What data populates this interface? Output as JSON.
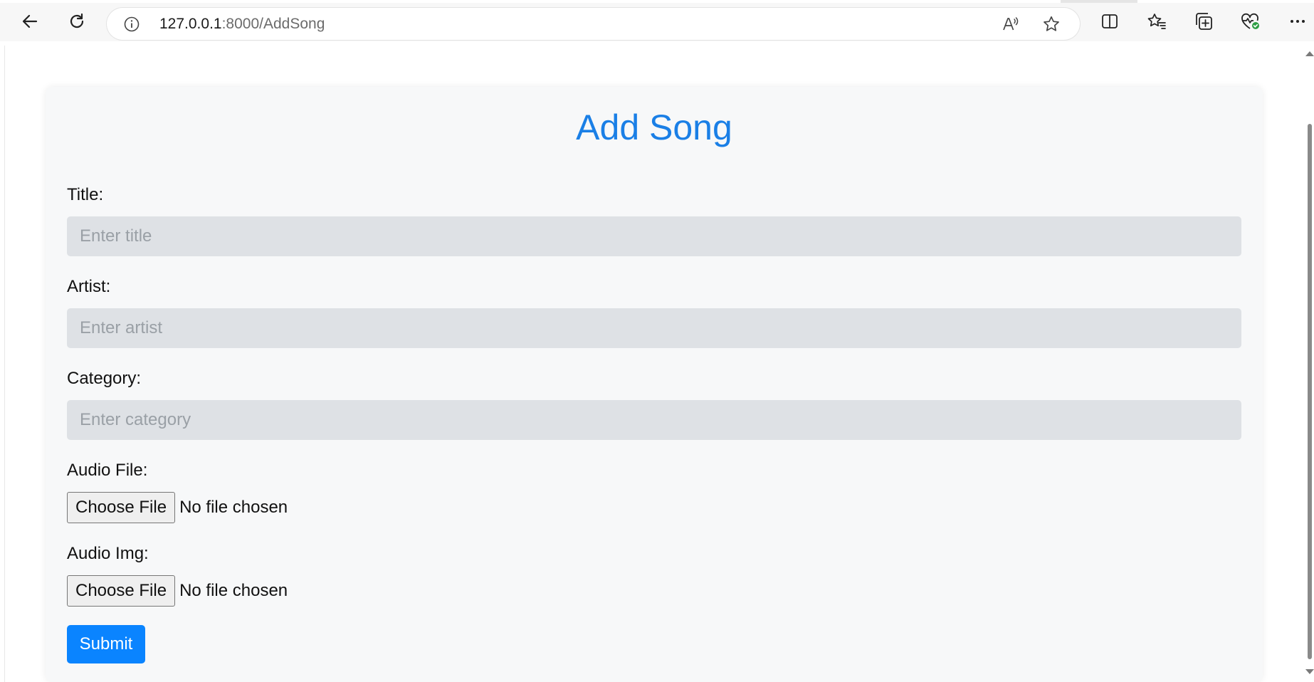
{
  "browser": {
    "url_host": "127.0.0.1",
    "url_rest": ":8000/AddSong"
  },
  "icons": {
    "back": "back-arrow-icon",
    "refresh": "refresh-icon",
    "info": "info-icon",
    "read_aloud": "read-aloud-icon",
    "favorite": "star-icon",
    "split_screen": "split-screen-icon",
    "favorites": "favorites-icon",
    "collections": "collections-icon",
    "browser_essentials": "heart-pulse-icon",
    "more": "more-icon"
  },
  "form": {
    "heading": "Add Song",
    "title_label": "Title:",
    "title_placeholder": "Enter title",
    "artist_label": "Artist:",
    "artist_placeholder": "Enter artist",
    "category_label": "Category:",
    "category_placeholder": "Enter category",
    "audio_file_label": "Audio File:",
    "audio_img_label": "Audio Img:",
    "choose_file_label": "Choose File",
    "no_file_text": "No file chosen",
    "submit_label": "Submit"
  },
  "colors": {
    "heading": "#1a7fe6",
    "submit_bg": "#0a84ff",
    "card_bg": "#f7f8f9",
    "input_bg": "#dee1e5"
  }
}
